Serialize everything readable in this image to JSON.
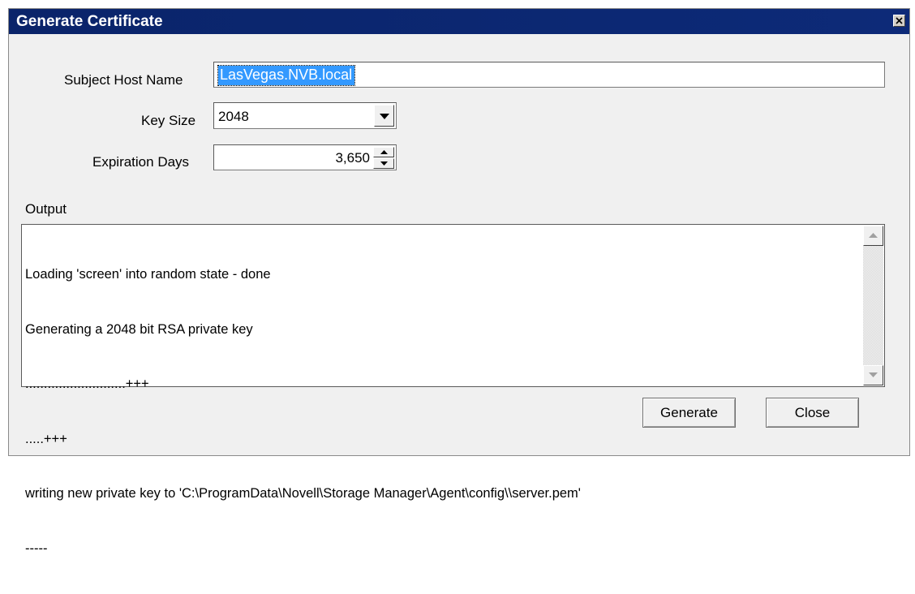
{
  "window": {
    "title": "Generate Certificate"
  },
  "form": {
    "subject_host_name_label": "Subject Host Name",
    "subject_host_name_value": "LasVegas.NVB.local",
    "key_size_label": "Key Size",
    "key_size_value": "2048",
    "expiration_days_label": "Expiration Days",
    "expiration_days_value": "3,650"
  },
  "output": {
    "label": "Output",
    "lines": [
      "Loading 'screen' into random state - done",
      "Generating a 2048 bit RSA private key",
      "...........................+++",
      ".....+++",
      "writing new private key to 'C:\\ProgramData\\Novell\\Storage Manager\\Agent\\config\\\\server.pem'",
      "-----"
    ]
  },
  "buttons": {
    "generate": "Generate",
    "close": "Close"
  },
  "icons": {
    "close": "close-icon",
    "dropdown": "chevron-down-icon",
    "spin_up": "spin-up-icon",
    "spin_down": "spin-down-icon",
    "scroll_up": "scroll-up-icon",
    "scroll_down": "scroll-down-icon"
  }
}
